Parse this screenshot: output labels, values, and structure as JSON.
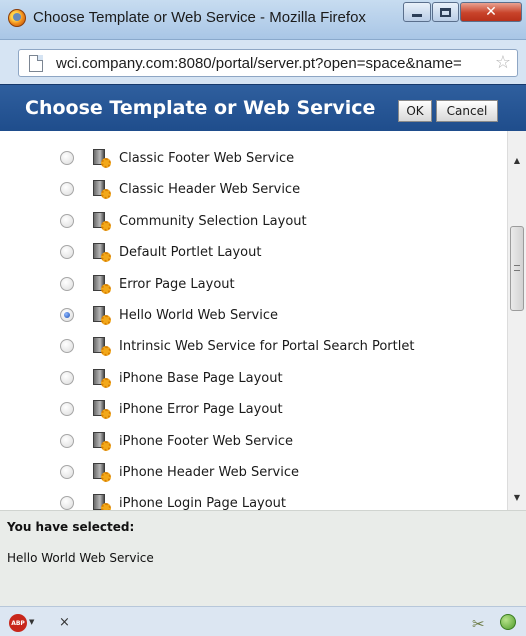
{
  "window": {
    "title": "Choose Template or Web Service - Mozilla Firefox",
    "controls": {
      "minimize": "minimize-icon",
      "maximize": "maximize-icon",
      "close": "✕"
    }
  },
  "urlbar": {
    "url": "wci.company.com:8080/portal/server.pt?open=space&name=",
    "star": "☆"
  },
  "dialog": {
    "title": "Choose Template or Web Service",
    "ok_label": "OK",
    "cancel_label": "Cancel",
    "header_color": "#24549a"
  },
  "list": {
    "items": [
      {
        "label": "Classic Footer Web Service",
        "selected": false
      },
      {
        "label": "Classic Header Web Service",
        "selected": false
      },
      {
        "label": "Community Selection Layout",
        "selected": false
      },
      {
        "label": "Default Portlet Layout",
        "selected": false
      },
      {
        "label": "Error Page Layout",
        "selected": false
      },
      {
        "label": "Hello World Web Service",
        "selected": true
      },
      {
        "label": "Intrinsic Web Service for Portal Search Portlet",
        "selected": false
      },
      {
        "label": "iPhone Base Page Layout",
        "selected": false
      },
      {
        "label": "iPhone Error Page Layout",
        "selected": false
      },
      {
        "label": "iPhone Footer Web Service",
        "selected": false
      },
      {
        "label": "iPhone Header Web Service",
        "selected": false
      },
      {
        "label": "iPhone Login Page Layout",
        "selected": false
      }
    ],
    "scroll_position": 0.3
  },
  "selection": {
    "heading": "You have selected:",
    "value": "Hello World Web Service"
  },
  "statusbar": {
    "adblock_label": "ABP",
    "close": "×"
  }
}
